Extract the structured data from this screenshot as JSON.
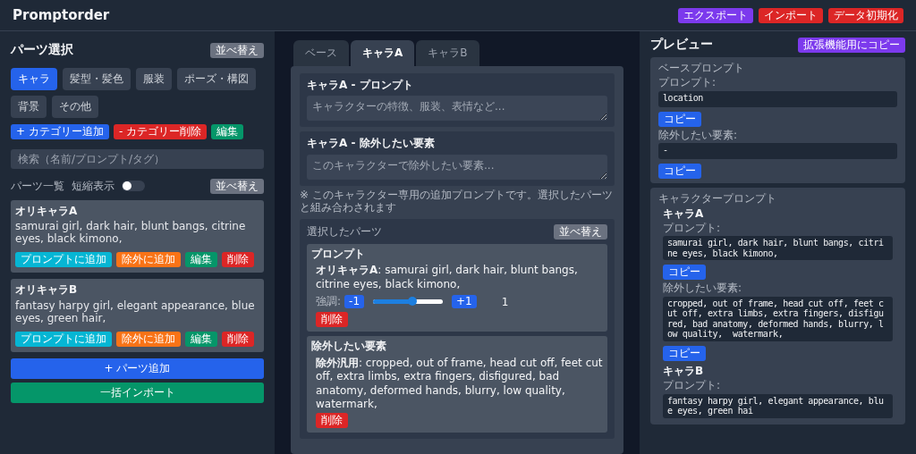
{
  "header": {
    "title": "Promptorder",
    "buttons": [
      {
        "label": "エクスポート",
        "color": "#7c3aed"
      },
      {
        "label": "インポート",
        "color": "#dc2626"
      },
      {
        "label": "データ初期化",
        "color": "#dc2626"
      }
    ]
  },
  "left": {
    "title": "パーツ選択",
    "sort": "並べ替え",
    "categories": [
      {
        "label": "キャラ",
        "selected": true
      },
      {
        "label": "髪型・髪色",
        "selected": false
      },
      {
        "label": "服装",
        "selected": false
      },
      {
        "label": "ポーズ・構図",
        "selected": false
      },
      {
        "label": "背景",
        "selected": false
      },
      {
        "label": "その他",
        "selected": false
      }
    ],
    "category_actions": [
      {
        "label": "+ カテゴリー追加",
        "color": "#2563eb"
      },
      {
        "label": "- カテゴリー削除",
        "color": "#dc2626"
      },
      {
        "label": "編集",
        "color": "#059669"
      }
    ],
    "search": {
      "placeholder": "検索（名前/プロンプト/タグ）"
    },
    "list_title": "パーツ一覧",
    "compact_label": "短縮表示",
    "compact_on": false,
    "list_sort": "並べ替え",
    "parts": [
      {
        "name": "オリキャラA",
        "prompt": "samurai girl, dark hair, blunt bangs, citrine eyes, black kimono,",
        "actions": [
          {
            "label": "プロンプトに追加",
            "color": "#06b6d4"
          },
          {
            "label": "除外に追加",
            "color": "#f97316"
          },
          {
            "label": "編集",
            "color": "#059669"
          },
          {
            "label": "削除",
            "color": "#dc2626"
          }
        ]
      },
      {
        "name": "オリキャラB",
        "prompt": "fantasy harpy girl, elegant appearance, blue eyes, green hair,",
        "actions": [
          {
            "label": "プロンプトに追加",
            "color": "#06b6d4"
          },
          {
            "label": "除外に追加",
            "color": "#f97316"
          },
          {
            "label": "編集",
            "color": "#059669"
          },
          {
            "label": "削除",
            "color": "#dc2626"
          }
        ]
      }
    ],
    "add_button": "+ パーツ追加",
    "import_button": "一括インポート"
  },
  "middle": {
    "tabs": [
      {
        "label": "ベース",
        "selected": false
      },
      {
        "label": "キャラA",
        "selected": true
      },
      {
        "label": "キャラB",
        "selected": false
      }
    ],
    "sections": [
      {
        "title": "キャラA - プロンプト",
        "placeholder": "キャラクターの特徴、服装、表情など..."
      },
      {
        "title": "キャラA - 除外したい要素",
        "placeholder": "このキャラクターで除外したい要素..."
      }
    ],
    "note": "※ このキャラクター専用の追加プロンプトです。選択したパーツと組み合わされます",
    "selected": {
      "title": "選択したパーツ",
      "sort": "並べ替え",
      "groups": [
        {
          "title": "プロンプト",
          "items": [
            {
              "kind": "weighted",
              "text": "**オリキャラA**: samurai girl, dark hair, blunt bangs, citrine eyes, black kimono,",
              "emphasis_label": "強調:",
              "minus": "-1",
              "plus": "+1",
              "level": 0.57,
              "reading": "1",
              "delete": "削除"
            }
          ]
        },
        {
          "title": "除外したい要素",
          "items": [
            {
              "kind": "plain",
              "text": "**除外汎用**: cropped, out of frame, head cut off, feet cut off, extra limbs, extra fingers, disfigured, bad anatomy, deformed hands, blurry, low quality, watermark,",
              "delete": "削除"
            }
          ]
        }
      ]
    }
  },
  "right": {
    "title": "プレビュー",
    "copy_ext": "拡張機能用にコピー",
    "base": {
      "title": "ベースプロンプト",
      "prompt_label": "プロンプト:",
      "prompt": "location",
      "prompt_copy": "コピー",
      "negative_label": "除外したい要素:",
      "negative": "-",
      "negative_copy": "コピー"
    },
    "characters": {
      "title": "キャラクタープロンプト",
      "items": [
        {
          "name": "キャラA",
          "prompt_label": "プロンプト:",
          "prompt": "samurai girl, dark hair, blunt bangs, citrine eyes, black kimono,",
          "prompt_copy": "コピー",
          "negative_label": "除外したい要素:",
          "negative": "cropped, out of frame, head cut off, feet cut off, extra limbs, extra fingers, disfigured, bad anatomy, deformed hands, blurry, low quality,  watermark,",
          "negative_copy": "コピー"
        },
        {
          "name": "キャラB",
          "prompt_label": "プロンプト:",
          "prompt": "fantasy harpy girl, elegant appearance, blue eyes, green hai"
        }
      ]
    }
  }
}
